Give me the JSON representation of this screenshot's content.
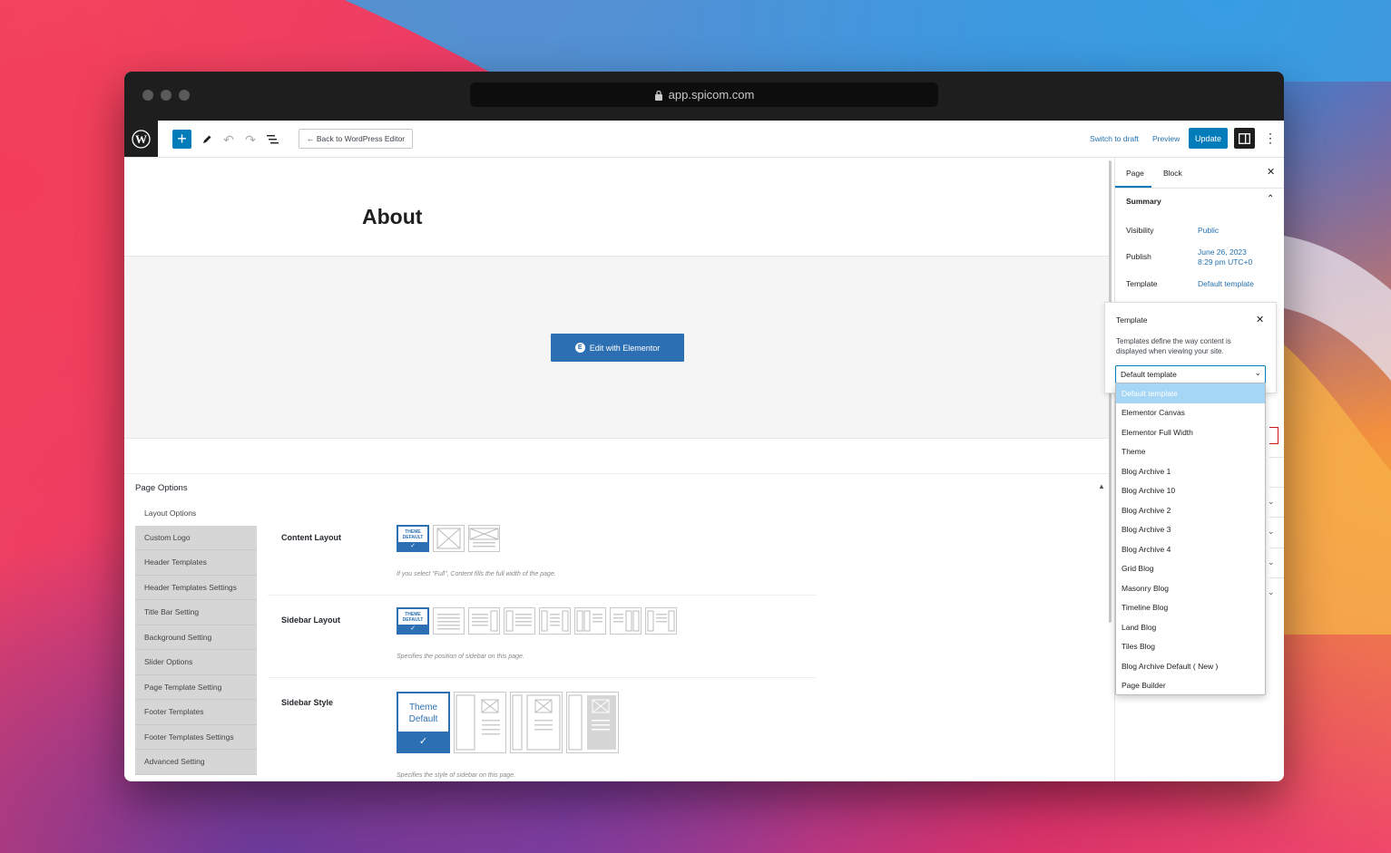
{
  "browser": {
    "url": "app.spicom.com"
  },
  "toolbar": {
    "add_label": "+",
    "back_label": "← Back to WordPress Editor",
    "switch_to_draft": "Switch to draft",
    "preview": "Preview",
    "update": "Update"
  },
  "editor": {
    "page_title": "About",
    "elementor_button": "Edit with Elementor"
  },
  "page_options": {
    "title": "Page Options",
    "nav": [
      {
        "label": "Layout Options"
      },
      {
        "label": "Custom Logo"
      },
      {
        "label": "Header Templates"
      },
      {
        "label": "Header Templates Settings"
      },
      {
        "label": "Title Bar Setting"
      },
      {
        "label": "Background Setting"
      },
      {
        "label": "Slider Options"
      },
      {
        "label": "Page Template Setting"
      },
      {
        "label": "Footer Templates"
      },
      {
        "label": "Footer Templates Settings"
      },
      {
        "label": "Advanced Setting"
      }
    ],
    "content_layout": {
      "label": "Content Layout",
      "theme_default_line1": "THEME",
      "theme_default_line2": "DEFAULT",
      "description": "If you select \"Full\", Content fills the full width of the page."
    },
    "sidebar_layout": {
      "label": "Sidebar Layout",
      "theme_default_line1": "THEME",
      "theme_default_line2": "DEFAULT",
      "description": "Specifies the position of sidebar on this page."
    },
    "sidebar_style": {
      "label": "Sidebar Style",
      "theme_default_line1": "Theme",
      "theme_default_line2": "Default",
      "description": "Specifies the style of sidebar on this page."
    }
  },
  "sidebar": {
    "tabs": [
      {
        "label": "Page"
      },
      {
        "label": "Block"
      }
    ],
    "summary_label": "Summary",
    "visibility_label": "Visibility",
    "visibility_value": "Public",
    "publish_label": "Publish",
    "publish_value_line1": "June 26, 2023",
    "publish_value_line2": "8:29 pm UTC+0",
    "template_label": "Template",
    "template_value": "Default template"
  },
  "template_popover": {
    "title": "Template",
    "description": "Templates define the way content is displayed when viewing your site.",
    "selected": "Default template",
    "options": [
      {
        "label": "Default template"
      },
      {
        "label": "Elementor Canvas"
      },
      {
        "label": "Elementor Full Width"
      },
      {
        "label": "Theme"
      },
      {
        "label": "Blog Archive 1"
      },
      {
        "label": "Blog Archive 10"
      },
      {
        "label": "Blog Archive 2"
      },
      {
        "label": "Blog Archive 3"
      },
      {
        "label": "Blog Archive 4"
      },
      {
        "label": "Grid Blog"
      },
      {
        "label": "Masonry Blog"
      },
      {
        "label": "Timeline Blog"
      },
      {
        "label": "Land Blog"
      },
      {
        "label": "Tiles Blog"
      },
      {
        "label": "Blog Archive Default ( New )"
      },
      {
        "label": "Page Builder"
      }
    ]
  },
  "colors": {
    "accent": "#007cba",
    "elementor": "#2d6fb3",
    "dropdown_selected": "#a6d6f5"
  }
}
